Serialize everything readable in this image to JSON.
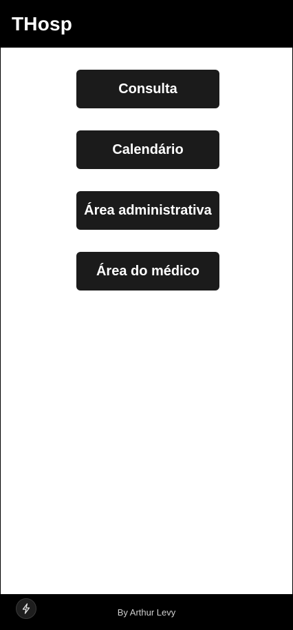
{
  "header": {
    "title": "THosp"
  },
  "menu": {
    "items": [
      {
        "label": "Consulta"
      },
      {
        "label": "Calendário"
      },
      {
        "label": "Área administrativa"
      },
      {
        "label": "Área do médico"
      }
    ]
  },
  "footer": {
    "text": "By Arthur Levy"
  },
  "floating_button": {
    "icon": "lightning-bolt-icon"
  },
  "colors": {
    "header_bg": "#000000",
    "button_bg": "#1b1b1b",
    "button_text": "#ffffff",
    "page_bg": "#ffffff",
    "footer_bg": "#000000",
    "footer_text": "#cfcfcf"
  }
}
